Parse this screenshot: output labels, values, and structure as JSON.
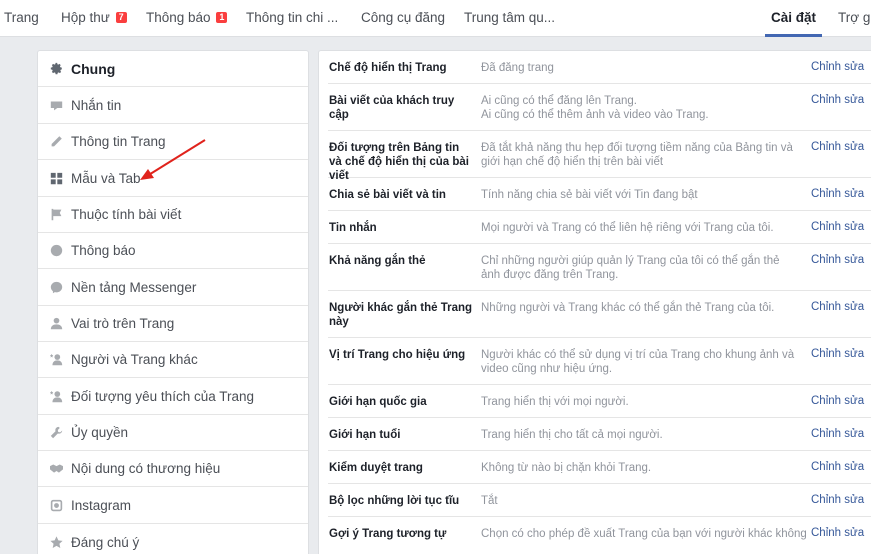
{
  "nav": {
    "items": [
      {
        "label": "Trang"
      },
      {
        "label": "Hộp thư",
        "badge": "7"
      },
      {
        "label": "Thông báo",
        "badge": "1"
      },
      {
        "label": "Thông tin chi ..."
      },
      {
        "label": "Công cụ đăng"
      },
      {
        "label": "Trung tâm qu..."
      },
      {
        "label": "Cài đặt",
        "active": true
      },
      {
        "label": "Trợ gi"
      }
    ]
  },
  "sidebar": {
    "items": [
      {
        "label": "Chung",
        "icon": "gear-icon"
      },
      {
        "label": "Nhắn tin",
        "icon": "message-icon"
      },
      {
        "label": "Thông tin Trang",
        "icon": "pencil-icon"
      },
      {
        "label": "Mẫu và Tab",
        "icon": "grid-icon"
      },
      {
        "label": "Thuộc tính bài viết",
        "icon": "flag-icon"
      },
      {
        "label": "Thông báo",
        "icon": "globe-icon"
      },
      {
        "label": "Nền tảng Messenger",
        "icon": "messenger-icon"
      },
      {
        "label": "Vai trò trên Trang",
        "icon": "person-icon"
      },
      {
        "label": "Người và Trang khác",
        "icon": "person-star-icon"
      },
      {
        "label": "Đối tượng yêu thích của Trang",
        "icon": "person-star-icon"
      },
      {
        "label": "Ủy quyền",
        "icon": "wrench-icon"
      },
      {
        "label": "Nội dung có thương hiệu",
        "icon": "handshake-icon"
      },
      {
        "label": "Instagram",
        "icon": "instagram-icon"
      },
      {
        "label": "Đáng chú ý",
        "icon": "star-icon"
      }
    ]
  },
  "settings": {
    "edit_label": "Chỉnh sửa",
    "rows": [
      {
        "label": "Chế độ hiển thị Trang",
        "desc": "Đã đăng trang"
      },
      {
        "label": "Bài viết của khách truy cập",
        "desc": "Ai cũng có thể đăng lên Trang.\nAi cũng có thể thêm ảnh và video vào Trang."
      },
      {
        "label": "Đối tượng trên Bảng tin và chế độ hiển thị của bài viết",
        "desc": "Đã tắt khả năng thu hẹp đối tượng tiềm năng của Bảng tin và giới hạn chế độ hiển thị trên bài viết"
      },
      {
        "label": "Chia sẻ bài viết và tin",
        "desc": "Tính năng chia sẻ bài viết với Tin đang bật"
      },
      {
        "label": "Tin nhắn",
        "desc": "Mọi người và Trang có thể liên hệ riêng với Trang của tôi."
      },
      {
        "label": "Khả năng gắn thẻ",
        "desc": "Chỉ những người giúp quản lý Trang của tôi có thể gắn thẻ ảnh được đăng trên Trang."
      },
      {
        "label": "Người khác gắn thẻ Trang này",
        "desc": "Những người và Trang khác có thể gắn thẻ Trang của tôi."
      },
      {
        "label": "Vị trí Trang cho hiệu ứng",
        "desc": "Người khác có thể sử dụng vị trí của Trang cho khung ảnh và video cũng như hiệu ứng."
      },
      {
        "label": "Giới hạn quốc gia",
        "desc": "Trang hiển thị với mọi người."
      },
      {
        "label": "Giới hạn tuổi",
        "desc": "Trang hiển thị cho tất cả mọi người."
      },
      {
        "label": "Kiểm duyệt trang",
        "desc": "Không từ nào bị chặn khỏi Trang."
      },
      {
        "label": "Bộ lọc những lời tục tĩu",
        "desc": "Tắt"
      },
      {
        "label": "Gợi ý Trang tương tự",
        "desc": "Chọn có cho phép đề xuất Trang của bạn với người khác không"
      }
    ]
  }
}
